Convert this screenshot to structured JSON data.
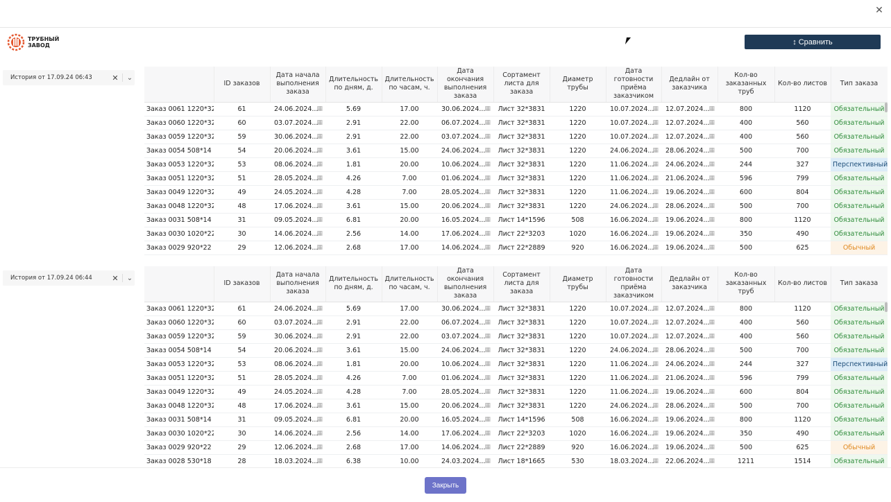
{
  "logo": {
    "line1": "ТРУБНЫЙ",
    "line2": "ЗАВОД"
  },
  "toolbar": {
    "compare_label": "Сравнить"
  },
  "footer": {
    "close_label": "Закрыть"
  },
  "histories": [
    {
      "label": "История от 17.09.24 06:43"
    },
    {
      "label": "История от 17.09.24 06:44"
    }
  ],
  "columns": [
    "",
    "ID заказов",
    "Дата начала выполнения заказа",
    "Длительность по дням, д.",
    "Длительность по часам, ч.",
    "Дата окончания выполнения заказа",
    "Сортамент листа для заказа",
    "Диаметр трубы",
    "Дата готовности приёма заказчиком",
    "Дедлайн от заказчика",
    "Кол-во заказанных труб",
    "Кол-во листов",
    "Тип заказа"
  ],
  "tables": [
    {
      "rows": [
        [
          "Заказ 0061 1220*32",
          "61",
          "24.06.2024...",
          "5.69",
          "17.00",
          "30.06.2024...",
          "Лист 32*3831",
          "1220",
          "10.07.2024...",
          "12.07.2024...",
          "800",
          "1120",
          "Обязательный"
        ],
        [
          "Заказ 0060 1220*32",
          "60",
          "03.07.2024...",
          "2.91",
          "22.00",
          "06.07.2024...",
          "Лист 32*3831",
          "1220",
          "10.07.2024...",
          "12.07.2024...",
          "400",
          "560",
          "Обязательный"
        ],
        [
          "Заказ 0059 1220*32",
          "59",
          "30.06.2024...",
          "2.91",
          "22.00",
          "03.07.2024...",
          "Лист 32*3831",
          "1220",
          "10.07.2024...",
          "12.07.2024...",
          "400",
          "560",
          "Обязательный"
        ],
        [
          "Заказ 0054 508*14",
          "54",
          "20.06.2024...",
          "3.61",
          "15.00",
          "24.06.2024...",
          "Лист 32*3831",
          "1220",
          "24.06.2024...",
          "28.06.2024...",
          "500",
          "700",
          "Обязательный"
        ],
        [
          "Заказ 0053 1220*32",
          "53",
          "08.06.2024...",
          "1.81",
          "20.00",
          "10.06.2024...",
          "Лист 32*3831",
          "1220",
          "11.06.2024...",
          "24.06.2024...",
          "244",
          "327",
          "Перспективный"
        ],
        [
          "Заказ 0051 1220*32",
          "51",
          "28.05.2024...",
          "4.26",
          "7.00",
          "01.06.2024...",
          "Лист 32*3831",
          "1220",
          "11.06.2024...",
          "21.06.2024...",
          "596",
          "799",
          "Обязательный"
        ],
        [
          "Заказ 0049 1220*32",
          "49",
          "24.05.2024...",
          "4.28",
          "7.00",
          "28.05.2024...",
          "Лист 32*3831",
          "1220",
          "11.06.2024...",
          "19.06.2024...",
          "600",
          "804",
          "Обязательный"
        ],
        [
          "Заказ 0048 1220*32",
          "48",
          "17.06.2024...",
          "3.61",
          "15.00",
          "20.06.2024...",
          "Лист 32*3831",
          "1220",
          "24.06.2024...",
          "28.06.2024...",
          "500",
          "700",
          "Обязательный"
        ],
        [
          "Заказ 0031 508*14",
          "31",
          "09.05.2024...",
          "6.81",
          "20.00",
          "16.05.2024...",
          "Лист 14*1596",
          "508",
          "16.06.2024...",
          "19.06.2024...",
          "800",
          "1120",
          "Обязательный"
        ],
        [
          "Заказ 0030 1020*22",
          "30",
          "14.06.2024...",
          "2.56",
          "14.00",
          "17.06.2024...",
          "Лист 22*3203",
          "1020",
          "16.06.2024...",
          "19.06.2024...",
          "350",
          "490",
          "Обязательный"
        ],
        [
          "Заказ 0029 920*22",
          "29",
          "12.06.2024...",
          "2.68",
          "17.00",
          "14.06.2024...",
          "Лист 22*2889",
          "920",
          "16.06.2024...",
          "19.06.2024...",
          "500",
          "625",
          "Обычный"
        ]
      ]
    },
    {
      "rows": [
        [
          "Заказ 0061 1220*32",
          "61",
          "24.06.2024...",
          "5.69",
          "17.00",
          "30.06.2024...",
          "Лист 32*3831",
          "1220",
          "10.07.2024...",
          "12.07.2024...",
          "800",
          "1120",
          "Обязательный"
        ],
        [
          "Заказ 0060 1220*32",
          "60",
          "03.07.2024...",
          "2.91",
          "22.00",
          "06.07.2024...",
          "Лист 32*3831",
          "1220",
          "10.07.2024...",
          "12.07.2024...",
          "400",
          "560",
          "Обязательный"
        ],
        [
          "Заказ 0059 1220*32",
          "59",
          "30.06.2024...",
          "2.91",
          "22.00",
          "03.07.2024...",
          "Лист 32*3831",
          "1220",
          "10.07.2024...",
          "12.07.2024...",
          "400",
          "560",
          "Обязательный"
        ],
        [
          "Заказ 0054 508*14",
          "54",
          "20.06.2024...",
          "3.61",
          "15.00",
          "24.06.2024...",
          "Лист 32*3831",
          "1220",
          "24.06.2024...",
          "28.06.2024...",
          "500",
          "700",
          "Обязательный"
        ],
        [
          "Заказ 0053 1220*32",
          "53",
          "08.06.2024...",
          "1.81",
          "20.00",
          "10.06.2024...",
          "Лист 32*3831",
          "1220",
          "11.06.2024...",
          "24.06.2024...",
          "244",
          "327",
          "Перспективный"
        ],
        [
          "Заказ 0051 1220*32",
          "51",
          "28.05.2024...",
          "4.26",
          "7.00",
          "01.06.2024...",
          "Лист 32*3831",
          "1220",
          "11.06.2024...",
          "21.06.2024...",
          "596",
          "799",
          "Обязательный"
        ],
        [
          "Заказ 0049 1220*32",
          "49",
          "24.05.2024...",
          "4.28",
          "7.00",
          "28.05.2024...",
          "Лист 32*3831",
          "1220",
          "11.06.2024...",
          "19.06.2024...",
          "600",
          "804",
          "Обязательный"
        ],
        [
          "Заказ 0048 1220*32",
          "48",
          "17.06.2024...",
          "3.61",
          "15.00",
          "20.06.2024...",
          "Лист 32*3831",
          "1220",
          "24.06.2024...",
          "28.06.2024...",
          "500",
          "700",
          "Обязательный"
        ],
        [
          "Заказ 0031 508*14",
          "31",
          "09.05.2024...",
          "6.81",
          "20.00",
          "16.05.2024...",
          "Лист 14*1596",
          "508",
          "16.06.2024...",
          "19.06.2024...",
          "800",
          "1120",
          "Обязательный"
        ],
        [
          "Заказ 0030 1020*22",
          "30",
          "14.06.2024...",
          "2.56",
          "14.00",
          "17.06.2024...",
          "Лист 22*3203",
          "1020",
          "16.06.2024...",
          "19.06.2024...",
          "350",
          "490",
          "Обязательный"
        ],
        [
          "Заказ 0029 920*22",
          "29",
          "12.06.2024...",
          "2.68",
          "17.00",
          "14.06.2024...",
          "Лист 22*2889",
          "920",
          "16.06.2024...",
          "19.06.2024...",
          "500",
          "625",
          "Обычный"
        ],
        [
          "Заказ 0028 530*18",
          "28",
          "18.03.2024...",
          "6.38",
          "10.00",
          "24.03.2024...",
          "Лист 18*1665",
          "530",
          "18.03.2024...",
          "22.06.2024...",
          "1211",
          "1514",
          "Обязательный"
        ]
      ]
    }
  ],
  "type_colors": {
    "Обязательный": "#2e8b3a",
    "Перспективный": "#1f4f7a",
    "Обычный": "#e08a22"
  },
  "icons": {
    "close": "close-icon",
    "calendar": "calendar-icon",
    "chevron": "chevron-down-icon",
    "sort": "sort-arrows-icon"
  }
}
